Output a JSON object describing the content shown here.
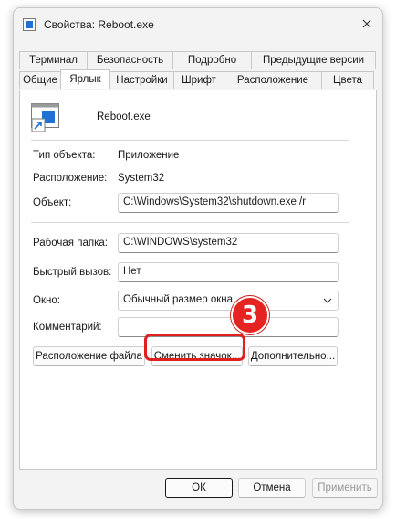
{
  "window": {
    "title": "Свойства: Reboot.exe"
  },
  "tabs": {
    "row1": [
      "Терминал",
      "Безопасность",
      "Подробно",
      "Предыдущие версии"
    ],
    "row2": [
      "Общие",
      "Ярлык",
      "Настройки",
      "Шрифт",
      "Расположение",
      "Цвета"
    ],
    "active": "Ярлык"
  },
  "shortcut": {
    "name": "Reboot.exe",
    "type_label": "Тип объекта:",
    "type_value": "Приложение",
    "location_label": "Расположение:",
    "location_value": "System32",
    "target_label": "Объект:",
    "target_value": "C:\\Windows\\System32\\shutdown.exe /r",
    "startin_label": "Рабочая папка:",
    "startin_value": "C:\\WINDOWS\\system32",
    "hotkey_label": "Быстрый вызов:",
    "hotkey_value": "Нет",
    "run_label": "Окно:",
    "run_value": "Обычный размер окна",
    "comment_label": "Комментарий:",
    "comment_value": ""
  },
  "buttons": {
    "open_location": "Расположение файла",
    "change_icon": "Сменить значок...",
    "advanced": "Дополнительно...",
    "ok": "ОК",
    "cancel": "Отмена",
    "apply": "Применить"
  },
  "annotation": {
    "step": "3",
    "color": "#e52321"
  }
}
